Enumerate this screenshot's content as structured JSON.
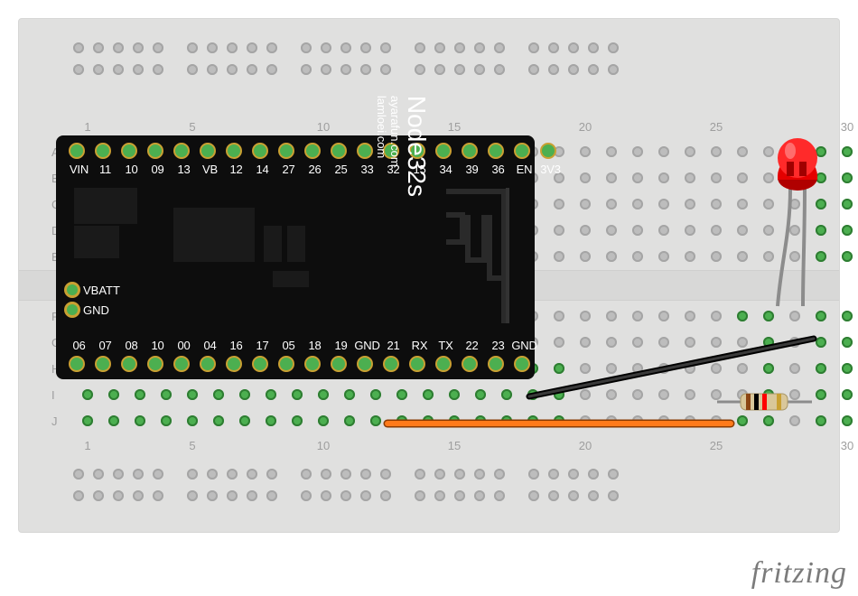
{
  "breadboard": {
    "column_labels": [
      "1",
      "",
      "",
      "",
      "5",
      "",
      "",
      "",
      "",
      "10",
      "",
      "",
      "",
      "",
      "15",
      "",
      "",
      "",
      "",
      "20",
      "",
      "",
      "",
      "",
      "25",
      "",
      "",
      "",
      "",
      "30"
    ],
    "row_labels_top": [
      "A",
      "B",
      "C",
      "D",
      "E"
    ],
    "row_labels_bottom": [
      "F",
      "G",
      "H",
      "I",
      "J"
    ]
  },
  "board": {
    "name": "Node32s",
    "sub1": "ayarafun.com",
    "sub2": "lamloei.com",
    "pins_top": [
      "VIN",
      "11",
      "10",
      "09",
      "13",
      "VB",
      "12",
      "14",
      "27",
      "26",
      "25",
      "33",
      "32",
      "15",
      "34",
      "39",
      "36",
      "EN",
      "3V3"
    ],
    "pins_bottom": [
      "06",
      "07",
      "08",
      "10",
      "00",
      "04",
      "16",
      "17",
      "05",
      "18",
      "19",
      "GND",
      "21",
      "RX",
      "TX",
      "22",
      "23",
      "GND"
    ],
    "side_labels": [
      "VBATT",
      "GND"
    ]
  },
  "components": {
    "led": "Red LED (5mm)",
    "resistor": "Resistor",
    "wire1": "GND jumper wire (black)",
    "wire2": "Signal jumper wire (orange)"
  },
  "watermark": "fritzing"
}
